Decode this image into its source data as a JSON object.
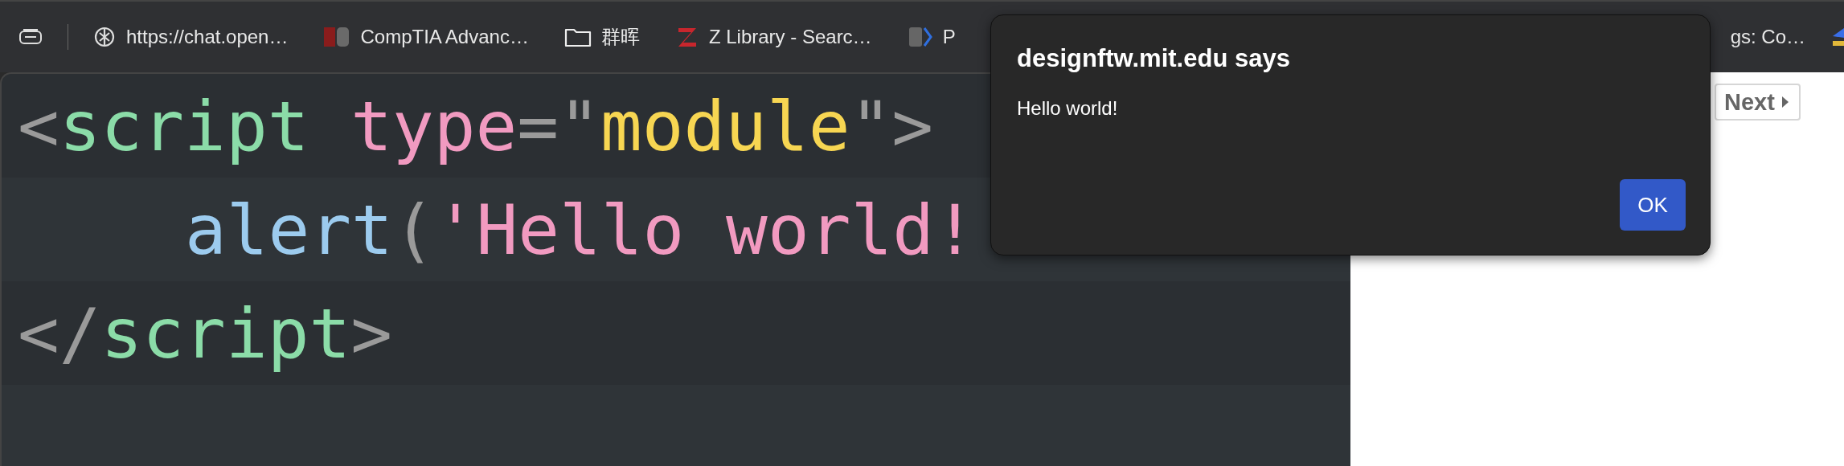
{
  "bookmarks": [
    {
      "kind": "knot",
      "label": "https://chat.open…"
    },
    {
      "kind": "pd",
      "label": "CompTIA Advanc…"
    },
    {
      "kind": "folder",
      "label": "群晖"
    },
    {
      "kind": "z",
      "label": "Z Library - Searc…"
    },
    {
      "kind": "doc",
      "label": "P"
    },
    {
      "label": "gs: Co…"
    },
    {
      "kind": "partial"
    }
  ],
  "code": {
    "lines": [
      {
        "tokens": [
          {
            "kind": "punct",
            "text": "<"
          },
          {
            "kind": "tag",
            "text": "script"
          },
          {
            "kind": "attr",
            "text": " type"
          },
          {
            "kind": "punct",
            "text": "=\""
          },
          {
            "kind": "string",
            "text": "module"
          },
          {
            "kind": "punct",
            "text": "\">"
          }
        ],
        "children": [
          {
            "tokens": [
              {
                "kind": "func",
                "text": "alert"
              },
              {
                "kind": "punct",
                "text": "("
              },
              {
                "kind": "attr",
                "text": "'Hello world!"
              }
            ]
          }
        ]
      },
      {
        "tokens": [
          {
            "kind": "punct",
            "text": "</"
          },
          {
            "kind": "tag",
            "text": "script"
          },
          {
            "kind": "punct",
            "text": ">"
          }
        ]
      }
    ]
  },
  "pager": {
    "next": "Next"
  },
  "dialog": {
    "title": "designftw.mit.edu says",
    "message": "Hello world!",
    "button": "OK"
  }
}
